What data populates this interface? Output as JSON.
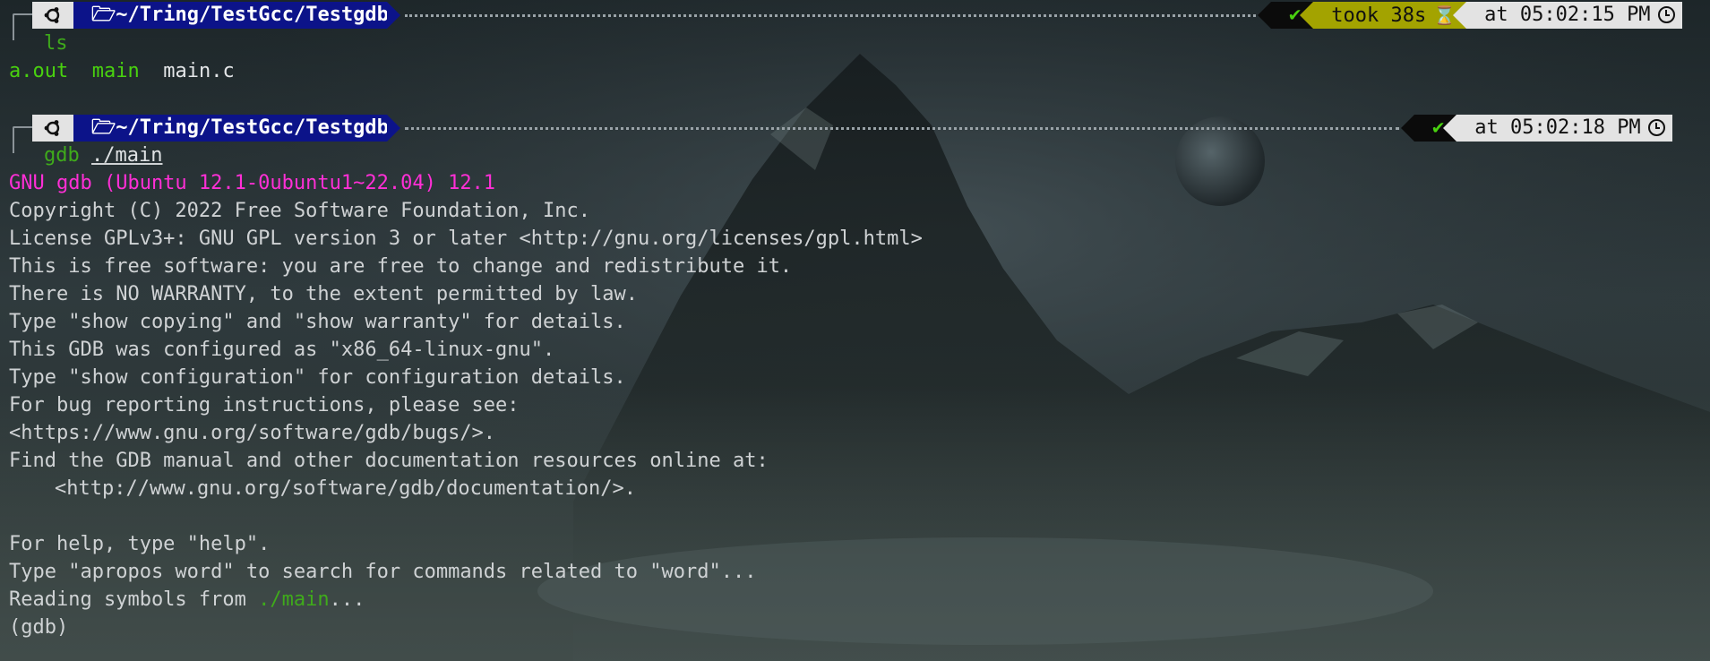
{
  "colors": {
    "prompt_dir_bg": "#0c1389",
    "os_segment_bg": "#e3e3e3",
    "status_check_bg": "#0b0b0b",
    "duration_bg": "#a3a300",
    "time_bg": "#e3e3e3",
    "cmd_green": "#3faa1b",
    "exec_green": "#49d10f",
    "gdb_banner_magenta": "#ff2fd6",
    "text": "#cfd2d4"
  },
  "prompt1": {
    "os_icon": "ubuntu-icon",
    "folder_icon": "folder-open-icon",
    "directory": "~/Tring/TestGcc/Testgdb",
    "status_check": "✔",
    "duration": "took 38s",
    "duration_icon": "hourglass-icon",
    "time": "at 05:02:15 PM",
    "clock_icon": "clock-icon",
    "command": "ls"
  },
  "ls_output": {
    "item1": "a.out",
    "item2": "main",
    "item3": "main.c"
  },
  "prompt2": {
    "os_icon": "ubuntu-icon",
    "folder_icon": "folder-open-icon",
    "directory": "~/Tring/TestGcc/Testgdb",
    "status_check": "✔",
    "time": "at 05:02:18 PM",
    "clock_icon": "clock-icon",
    "command": "gdb",
    "argument": "./main"
  },
  "gdb": {
    "banner": "GNU gdb (Ubuntu 12.1-0ubuntu1~22.04) 12.1",
    "lines": [
      "Copyright (C) 2022 Free Software Foundation, Inc.",
      "License GPLv3+: GNU GPL version 3 or later <http://gnu.org/licenses/gpl.html>",
      "This is free software: you are free to change and redistribute it.",
      "There is NO WARRANTY, to the extent permitted by law.",
      "Type \"show copying\" and \"show warranty\" for details.",
      "This GDB was configured as \"x86_64-linux-gnu\".",
      "Type \"show configuration\" for configuration details.",
      "For bug reporting instructions, please see:",
      "<https://www.gnu.org/software/gdb/bugs/>.",
      "Find the GDB manual and other documentation resources online at:",
      "<http://www.gnu.org/software/gdb/documentation/>.",
      "For help, type \"help\".",
      "Type \"apropos word\" to search for commands related to \"word\"..."
    ],
    "reading_prefix": "Reading symbols from ",
    "reading_file": "./main",
    "reading_suffix": "...",
    "prompt": "(gdb)"
  }
}
